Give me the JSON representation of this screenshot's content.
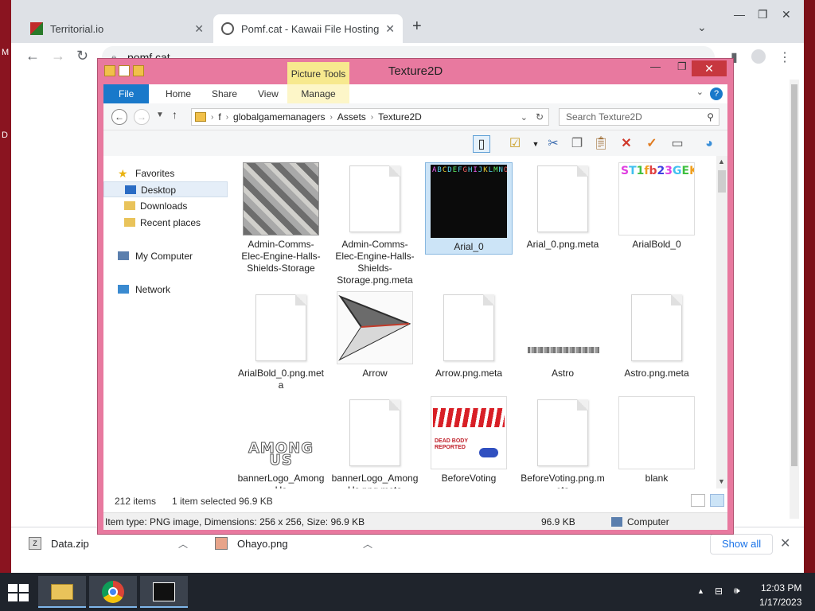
{
  "browser": {
    "tabs": [
      {
        "title": "Territorial.io"
      },
      {
        "title": "Pomf.cat - Kawaii File Hosting"
      }
    ],
    "url": "pomf.cat"
  },
  "explorer": {
    "title": "Texture2D",
    "picture_tools": "Picture Tools",
    "ribbon_tabs": [
      "File",
      "Home",
      "Share",
      "View",
      "Manage"
    ],
    "breadcrumb": [
      "f",
      "globalgamemanagers",
      "Assets",
      "Texture2D"
    ],
    "search_placeholder": "Search Texture2D",
    "nav": {
      "favorites": "Favorites",
      "desktop": "Desktop",
      "downloads": "Downloads",
      "recent": "Recent places",
      "computer": "My Computer",
      "network": "Network"
    },
    "files": [
      {
        "name": "Admin-Comms-Elec-Engine-Halls-Shields-Storage",
        "kind": "image-map"
      },
      {
        "name": "Admin-Comms-Elec-Engine-Halls-Shields-Storage.png.meta",
        "kind": "doc"
      },
      {
        "name": "Arial_0",
        "kind": "image-font",
        "selected": true
      },
      {
        "name": "Arial_0.png.meta",
        "kind": "doc"
      },
      {
        "name": "ArialBold_0",
        "kind": "image-fontbold"
      },
      {
        "name": "ArialBold_0.png.meta",
        "kind": "doc"
      },
      {
        "name": "Arrow",
        "kind": "image-arrow"
      },
      {
        "name": "Arrow.png.meta",
        "kind": "doc"
      },
      {
        "name": "Astro",
        "kind": "image-astro"
      },
      {
        "name": "Astro.png.meta",
        "kind": "doc"
      },
      {
        "name": "bannerLogo_AmongUs",
        "kind": "image-banner"
      },
      {
        "name": "bannerLogo_AmongUs.png.meta",
        "kind": "doc"
      },
      {
        "name": "BeforeVoting",
        "kind": "image-voting"
      },
      {
        "name": "BeforeVoting.png.meta",
        "kind": "doc"
      },
      {
        "name": "blank",
        "kind": "blank"
      }
    ],
    "status_count": "212 items",
    "status_selected": "1 item selected  96.9 KB",
    "detail_info": "Item type: PNG image, Dimensions: 256 x 256, Size: 96.9 KB",
    "detail_size": "96.9 KB",
    "detail_location": "Computer"
  },
  "downloads": [
    {
      "name": "Data.zip"
    },
    {
      "name": "Ohayo.png"
    }
  ],
  "show_all": "Show all",
  "clock": {
    "time": "12:03 PM",
    "date": "1/17/2023"
  },
  "colors": {
    "explorer_frame": "#e8799f",
    "chrome_frame": "#dee1e6",
    "selection": "#cce4f7"
  }
}
